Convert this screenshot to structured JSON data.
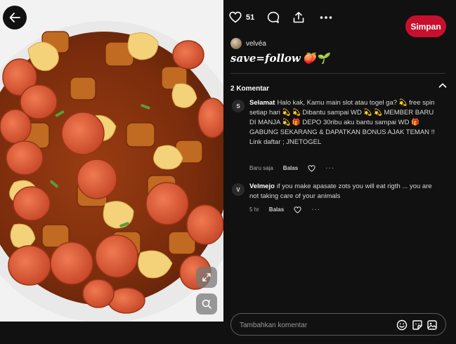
{
  "pin": {
    "like_count": "51",
    "save_label": "Simpan",
    "author_name": "velvéa",
    "title": "save=follow",
    "title_emojis": "🍑🌱"
  },
  "comments_section": {
    "header": "2 Komentar",
    "items": [
      {
        "initial": "S",
        "author": "Selamat",
        "text": "Halo kak, Kamu main slot atau togel ga? 💫 free spin setiap hari 💫 💫 Dibantu sampai WD 💫 💫 MEMBER BARU DI MANJA 💫 🎁 DEPO 30ribu aku bantu sampai WD 🎁 GABUNG SEKARANG & DAPATKAN BONUS AJAK TEMAN !! Link daftar ; JNETOGEL",
        "time": "Baru saja",
        "reply_label": "Balas"
      },
      {
        "initial": "V",
        "author": "Velmejo",
        "text": "if you make apasate zots you will eat rigth ... you are not taking care of your animals",
        "time": "5 hr",
        "reply_label": "Balas"
      }
    ]
  },
  "composer": {
    "placeholder": "Tambahkan komentar"
  },
  "colors": {
    "save_button": "#c8102e",
    "panel_bg": "#111111"
  },
  "icons": [
    "back-arrow-icon",
    "heart-icon",
    "comment-bubble-icon",
    "share-icon",
    "more-dots-icon",
    "expand-icon",
    "visual-search-icon",
    "chevron-up-icon",
    "emoji-icon",
    "sticker-icon",
    "image-icon"
  ]
}
